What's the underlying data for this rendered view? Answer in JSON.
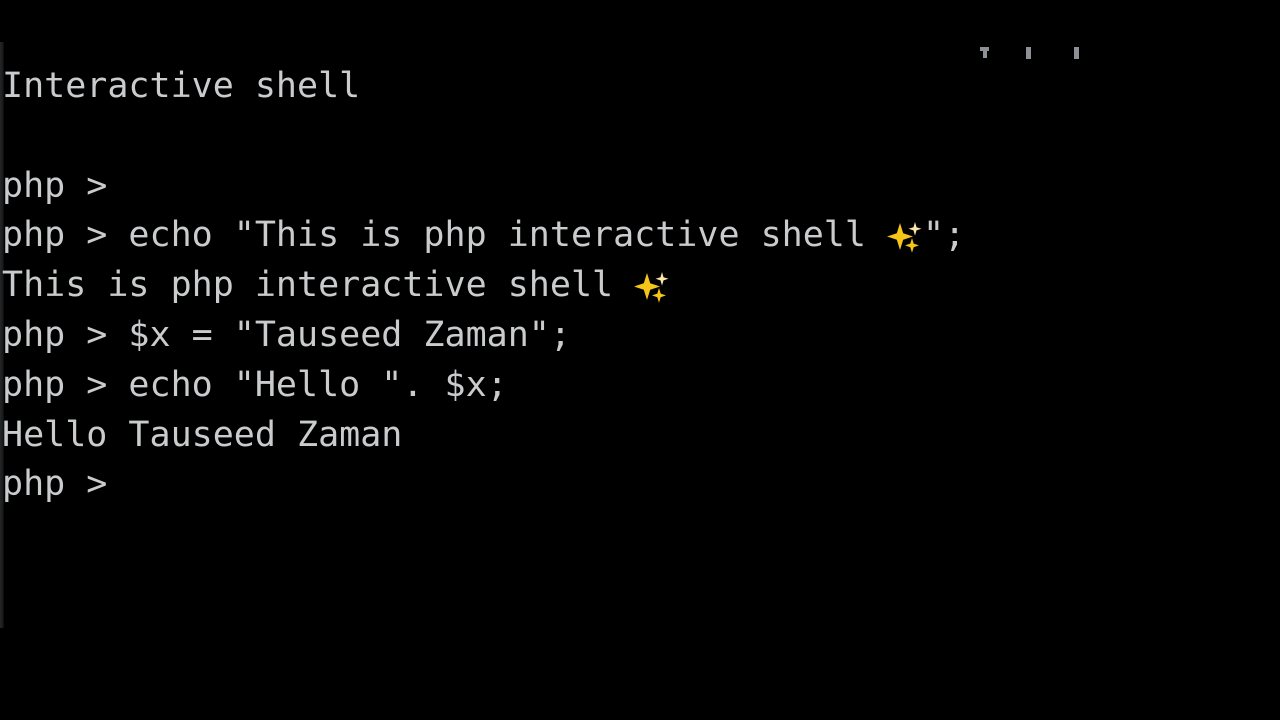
{
  "app": {
    "type": "terminal",
    "background_color": "#000000",
    "text_color": "#c9cbcd",
    "emoji_color": "#f5c518"
  },
  "terminal": {
    "header": "Interactive shell",
    "prompt": "php >",
    "lines": [
      {
        "id": "header",
        "kind": "output",
        "text": "Interactive shell"
      },
      {
        "id": "spacer-1",
        "kind": "blank",
        "text": " "
      },
      {
        "id": "prompt-1",
        "kind": "prompt",
        "text": "php >"
      },
      {
        "id": "input-1",
        "kind": "prompt",
        "text": "php > echo \"This is php interactive shell ",
        "emoji": "sparkles",
        "text_after": "\";"
      },
      {
        "id": "output-1",
        "kind": "output",
        "text": "This is php interactive shell ",
        "emoji": "sparkles",
        "text_after": ""
      },
      {
        "id": "input-2",
        "kind": "prompt",
        "text": "php > $x = \"Tauseed Zaman\";"
      },
      {
        "id": "input-3",
        "kind": "prompt",
        "text": "php > echo \"Hello \". $x;"
      },
      {
        "id": "output-2",
        "kind": "output",
        "text": "Hello Tauseed Zaman"
      },
      {
        "id": "prompt-2",
        "kind": "prompt",
        "text": "php >"
      }
    ]
  },
  "clipped_top_line": {
    "description": "bottom pixel remnants of a scrolled-off text line",
    "fragment_count": 3
  }
}
